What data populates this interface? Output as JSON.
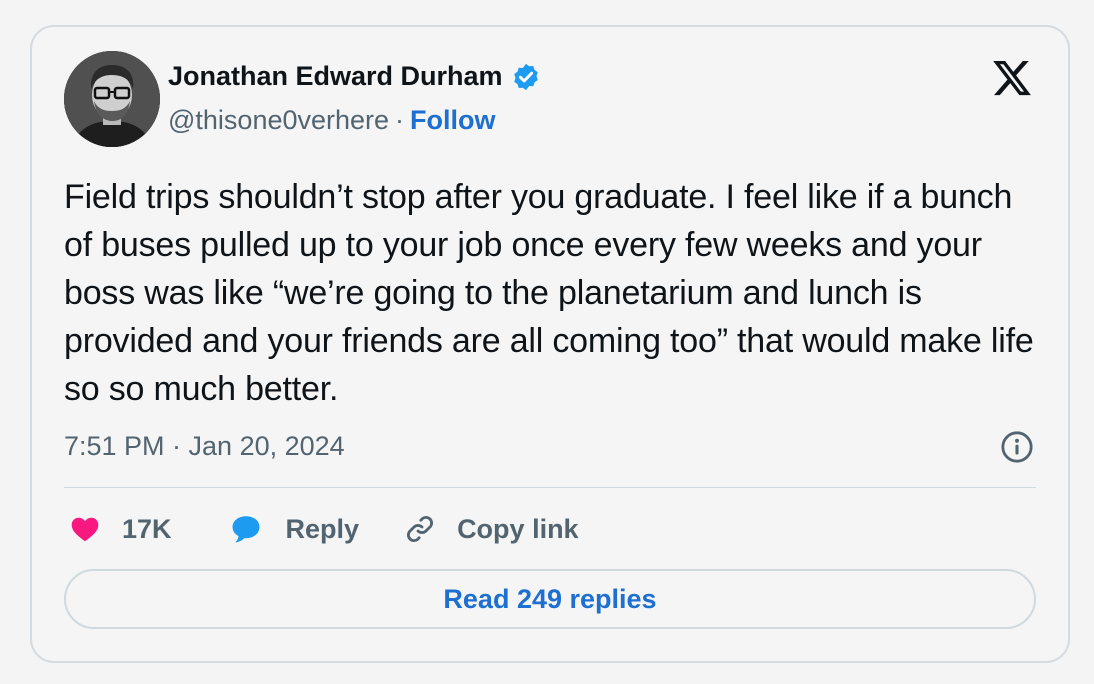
{
  "author": {
    "display_name": "Jonathan Edward Durham",
    "handle": "@thisone0verhere",
    "separator": "·",
    "follow_label": "Follow",
    "verified": true
  },
  "tweet": {
    "text": "Field trips shouldn’t stop after you graduate. I feel like if a bunch of buses pulled up to your job once every few weeks and your boss was like “we’re going to the planetarium and lunch is provided and your friends are all coming too” that would make life so so much better.",
    "timestamp": "7:51 PM · Jan 20, 2024"
  },
  "actions": {
    "like_count": "17K",
    "reply_label": "Reply",
    "copy_link_label": "Copy link"
  },
  "read_replies_label": "Read 249 replies",
  "colors": {
    "accent": "#1d6fd1",
    "like": "#f91880",
    "reply_icon": "#1d9bf0",
    "verified": "#1d9bf0"
  },
  "icons": [
    "avatar",
    "verified-badge-icon",
    "x-logo-icon",
    "info-icon",
    "heart-icon",
    "reply-bubble-icon",
    "link-icon"
  ]
}
